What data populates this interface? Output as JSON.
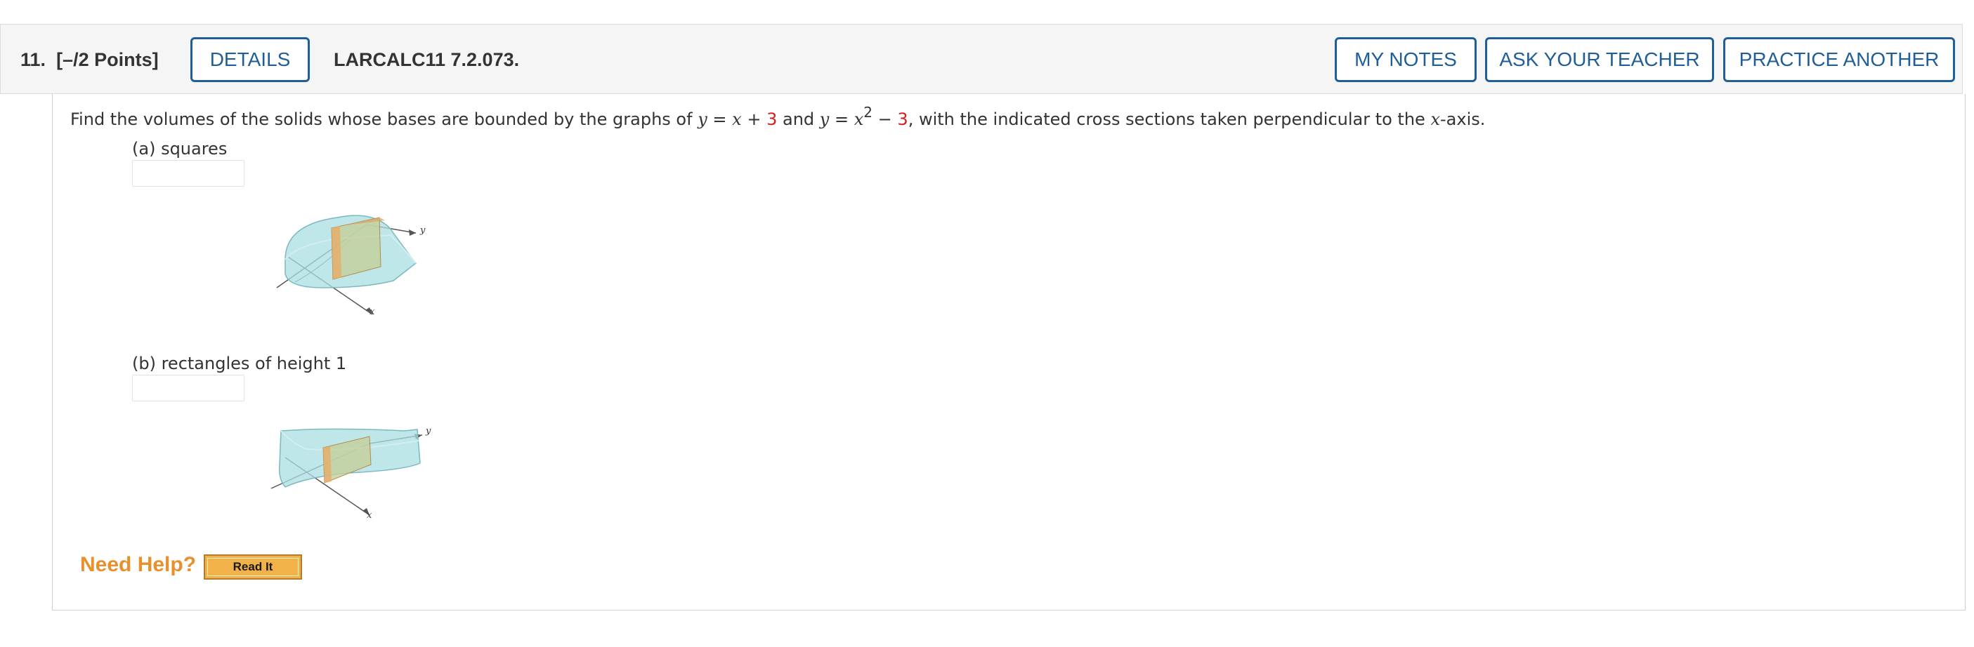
{
  "header": {
    "question_number": "11.",
    "points": "[–/2 Points]",
    "details_label": "DETAILS",
    "problem_code": "LARCALC11 7.2.073.",
    "my_notes_label": "MY NOTES",
    "ask_teacher_label": "ASK YOUR TEACHER",
    "practice_another_label": "PRACTICE ANOTHER"
  },
  "question": {
    "text_1": "Find the volumes of the solids whose bases are bounded by the graphs of",
    "var_y": "y",
    "eq": "=",
    "var_x": "x",
    "plus": "+",
    "num_3": "3",
    "and": "and",
    "exp_2": "2",
    "minus": "−",
    "text_2": ", with the indicated cross sections taken perpendicular to the",
    "axis_text": "-axis."
  },
  "parts": [
    {
      "label": "(a) squares",
      "answer_value": "",
      "figure_x_label": "x",
      "figure_y_label": "y"
    },
    {
      "label": "(b) rectangles of height 1",
      "answer_value": "",
      "figure_x_label": "x",
      "figure_y_label": "y"
    }
  ],
  "help": {
    "need_help_label": "Need Help?",
    "read_it_label": "Read It"
  },
  "colors": {
    "accent_blue": "#1f5e99",
    "help_orange": "#e8912c",
    "highlight_red": "#d32020"
  }
}
